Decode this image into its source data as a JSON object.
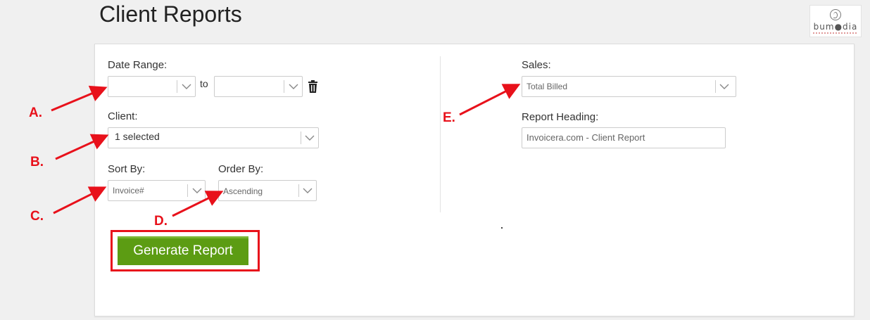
{
  "page": {
    "title": "Client Reports"
  },
  "logo": {
    "text": "bum●dia"
  },
  "form": {
    "date_range": {
      "label": "Date Range:",
      "from_value": "",
      "to_label": "to",
      "to_value": ""
    },
    "client": {
      "label": "Client:",
      "value": "1 selected"
    },
    "sort_by": {
      "label": "Sort By:",
      "value": "Invoice#"
    },
    "order_by": {
      "label": "Order By:",
      "value": "Ascending"
    },
    "sales": {
      "label": "Sales:",
      "value": "Total Billed"
    },
    "report_heading": {
      "label": "Report Heading:",
      "value": "Invoicera.com - Client Report"
    },
    "generate_label": "Generate Report"
  },
  "annotations": {
    "a": "A.",
    "b": "B.",
    "c": "C.",
    "d": "D.",
    "e": "E."
  },
  "colors": {
    "accent_green": "#5c9c13",
    "annotation_red": "#e8111b"
  }
}
